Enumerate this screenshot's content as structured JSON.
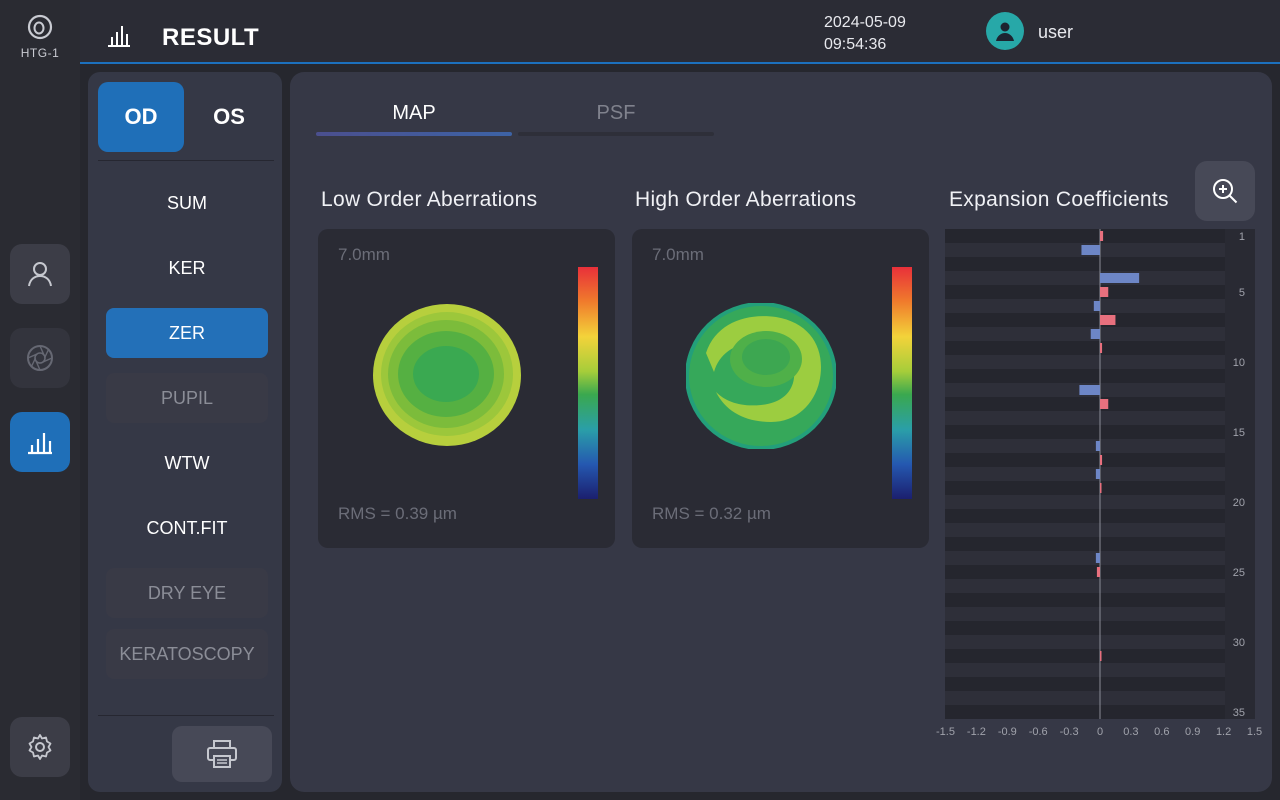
{
  "app": {
    "logo_text": "HTG-1"
  },
  "header": {
    "title": "RESULT",
    "date": "2024-05-09",
    "time": "09:54:36",
    "user": "user"
  },
  "sidebar": {
    "eyes": [
      {
        "label": "OD",
        "selected": true
      },
      {
        "label": "OS",
        "selected": false
      }
    ],
    "items": [
      {
        "label": "SUM",
        "state": "normal"
      },
      {
        "label": "KER",
        "state": "normal"
      },
      {
        "label": "ZER",
        "state": "active"
      },
      {
        "label": "PUPIL",
        "state": "disabled"
      },
      {
        "label": "WTW",
        "state": "normal"
      },
      {
        "label": "CONT.FIT",
        "state": "normal"
      },
      {
        "label": "DRY EYE",
        "state": "disabled"
      },
      {
        "label": "KERATOSCOPY",
        "state": "disabled"
      }
    ]
  },
  "tabs": [
    {
      "label": "MAP",
      "selected": true
    },
    {
      "label": "PSF",
      "selected": false
    }
  ],
  "sections": {
    "low": "Low Order Aberrations",
    "high": "High Order Aberrations",
    "coef": "Expansion Coefficients"
  },
  "maps": {
    "low": {
      "size": "7.0mm",
      "rms": "RMS = 0.39 µm"
    },
    "high": {
      "size": "7.0mm",
      "rms": "RMS = 0.32 µm"
    }
  },
  "colors": {
    "accent": "#1f6fb8",
    "positive": "#e8707e",
    "negative": "#6d86c6"
  },
  "chart_data": {
    "type": "bar",
    "orientation": "horizontal",
    "xlim": [
      -1.5,
      1.5
    ],
    "x_ticks": [
      "-1.5",
      "-1.2",
      "-0.9",
      "-0.6",
      "-0.3",
      "0",
      "0.3",
      "0.6",
      "0.9",
      "1.2",
      "1.5"
    ],
    "y_ticks": [
      "1",
      "5",
      "10",
      "15",
      "20",
      "25",
      "30",
      "35"
    ],
    "index_range": [
      1,
      35
    ],
    "values": [
      0.03,
      -0.18,
      0,
      0.38,
      0.08,
      -0.06,
      0.15,
      -0.09,
      0.02,
      0,
      0,
      -0.2,
      0.08,
      0,
      0,
      -0.04,
      0.02,
      -0.04,
      0.01,
      0,
      0,
      0,
      0,
      -0.04,
      -0.03,
      0,
      0,
      0,
      0,
      0,
      0.01,
      0,
      0,
      0,
      0
    ]
  }
}
